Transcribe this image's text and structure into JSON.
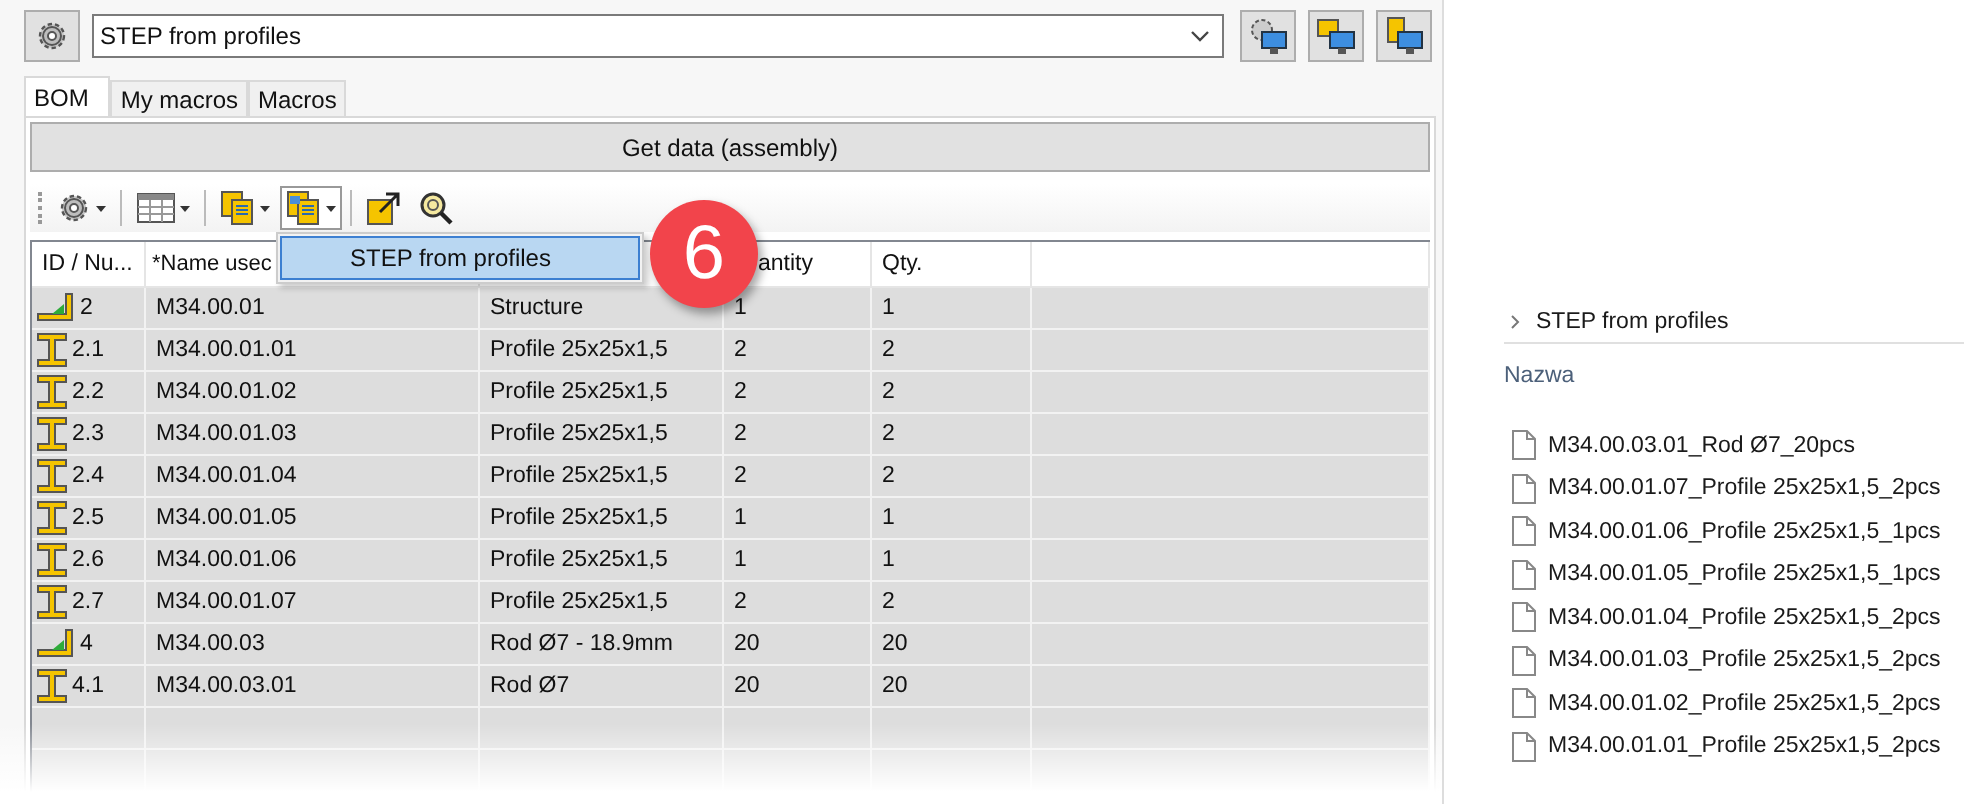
{
  "top_bar": {
    "combo_value": "STEP from profiles"
  },
  "tabs": [
    {
      "label": "BOM",
      "selected": true
    },
    {
      "label": "My macros",
      "selected": false
    },
    {
      "label": "Macros",
      "selected": false
    }
  ],
  "get_data_button": "Get data (assembly)",
  "menu": {
    "items": [
      {
        "label": "STEP from profiles",
        "selected": true
      }
    ]
  },
  "badge": "6",
  "table": {
    "header": {
      "id": "ID / Nu...",
      "name": "*Name usec",
      "quantity": "antity",
      "qty": "Qty."
    },
    "rows": [
      {
        "kind": "assembly",
        "id": "2",
        "name": "M34.00.01",
        "column_3": "Structure",
        "quantity": "1",
        "qty": "1"
      },
      {
        "kind": "part",
        "id": "2.1",
        "name": "M34.00.01.01",
        "column_3": "Profile 25x25x1,5",
        "quantity": "2",
        "qty": "2"
      },
      {
        "kind": "part",
        "id": "2.2",
        "name": "M34.00.01.02",
        "column_3": "Profile 25x25x1,5",
        "quantity": "2",
        "qty": "2"
      },
      {
        "kind": "part",
        "id": "2.3",
        "name": "M34.00.01.03",
        "column_3": "Profile 25x25x1,5",
        "quantity": "2",
        "qty": "2"
      },
      {
        "kind": "part",
        "id": "2.4",
        "name": "M34.00.01.04",
        "column_3": "Profile 25x25x1,5",
        "quantity": "2",
        "qty": "2"
      },
      {
        "kind": "part",
        "id": "2.5",
        "name": "M34.00.01.05",
        "column_3": "Profile 25x25x1,5",
        "quantity": "1",
        "qty": "1"
      },
      {
        "kind": "part",
        "id": "2.6",
        "name": "M34.00.01.06",
        "column_3": "Profile 25x25x1,5",
        "quantity": "1",
        "qty": "1"
      },
      {
        "kind": "part",
        "id": "2.7",
        "name": "M34.00.01.07",
        "column_3": "Profile 25x25x1,5",
        "quantity": "2",
        "qty": "2"
      },
      {
        "kind": "assembly",
        "id": "4",
        "name": "M34.00.03",
        "column_3": "Rod Ø7 - 18.9mm",
        "quantity": "20",
        "qty": "20"
      },
      {
        "kind": "part",
        "id": "4.1",
        "name": "M34.00.03.01",
        "column_3": "Rod Ø7",
        "quantity": "20",
        "qty": "20"
      }
    ]
  },
  "explorer": {
    "breadcrumb": "STEP from profiles",
    "column": "Nazwa",
    "files": [
      "M34.00.03.01_Rod Ø7_20pcs",
      "M34.00.01.07_Profile 25x25x1,5_2pcs",
      "M34.00.01.06_Profile 25x25x1,5_1pcs",
      "M34.00.01.05_Profile 25x25x1,5_1pcs",
      "M34.00.01.04_Profile 25x25x1,5_2pcs",
      "M34.00.01.03_Profile 25x25x1,5_2pcs",
      "M34.00.01.02_Profile 25x25x1,5_2pcs",
      "M34.00.01.01_Profile 25x25x1,5_2pcs"
    ]
  }
}
